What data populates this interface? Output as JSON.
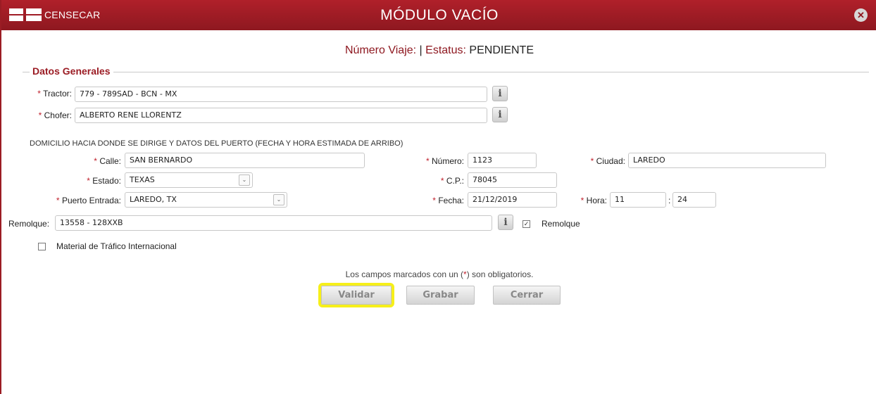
{
  "header": {
    "logo_text": "CENSECAR",
    "title": "MÓDULO VACÍO",
    "close_icon": "close-icon"
  },
  "trip": {
    "numero_label": "Número Viaje:",
    "separator": "|",
    "estatus_label": "Estatus:",
    "estatus_value": "PENDIENTE"
  },
  "datos_generales": {
    "legend": "Datos Generales",
    "tractor_label": "Tractor:",
    "tractor_value": "779 - 789SAD - BCN - MX",
    "chofer_label": "Chofer:",
    "chofer_value": "ALBERTO RENE LLORENTZ"
  },
  "domicilio": {
    "heading": "DOMICILIO HACIA DONDE SE DIRIGE Y DATOS DEL PUERTO (FECHA Y HORA ESTIMADA DE ARRIBO)",
    "calle_label": "Calle:",
    "calle_value": "SAN BERNARDO",
    "numero_label": "Número:",
    "numero_value": "1123",
    "ciudad_label": "Ciudad:",
    "ciudad_value": "LAREDO",
    "estado_label": "Estado:",
    "estado_value": "TEXAS",
    "cp_label": "C.P.:",
    "cp_value": "78045",
    "puerto_label": "Puerto Entrada:",
    "puerto_value": "LAREDO, TX",
    "fecha_label": "Fecha:",
    "fecha_value": "21/12/2019",
    "hora_label": "Hora:",
    "hora_value": "11",
    "minutos_sep": ":",
    "minutos_value": "24"
  },
  "remolque": {
    "label": "Remolque:",
    "value": "13558 - 128XXB",
    "checkbox_label": "Remolque",
    "checkbox_checked": true
  },
  "material": {
    "label": "Material de Tráfico Internacional",
    "checked": false
  },
  "footer": {
    "note_prefix": "Los campos marcados con un (",
    "note_star": "*",
    "note_suffix": ") son obligatorios.",
    "validar_label": "Validar",
    "grabar_label": "Grabar",
    "cerrar_label": "Cerrar"
  },
  "colors": {
    "brand": "#9b1c24",
    "required": "#c0202c",
    "highlight": "#f6ef1a"
  },
  "required_mark": "*",
  "info_glyph": "i",
  "check_glyph": "✓",
  "dropdown_glyph": "⌄",
  "close_glyph": "✕"
}
